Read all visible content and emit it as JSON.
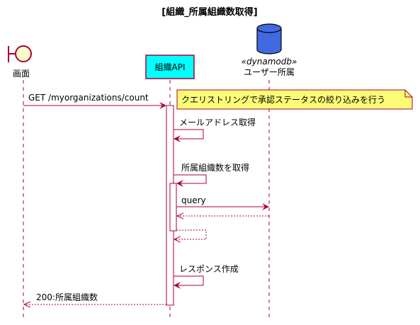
{
  "title": "[組織_所属組織数取得]",
  "participants": {
    "screen": {
      "label": "画面",
      "icon": "boundary-icon"
    },
    "api": {
      "label": "組織API"
    },
    "db": {
      "stereotype": "«dynamodb»",
      "label": "ユーザー所属",
      "icon": "database-icon"
    }
  },
  "messages": {
    "get_count": "GET /myorganizations/count",
    "mail": "メールアドレス取得",
    "orgs": "所属組織数を取得",
    "query": "query",
    "response": "レスポンス作成",
    "result": "200:所属組織数"
  },
  "note": "クエリストリングで承認ステータスの絞り込みを行う",
  "colors": {
    "arrow": "#A80036",
    "api_box": "#00FFFF",
    "db": "#4169E1",
    "boundary": "#FEFECE",
    "note": "#FBFB77"
  }
}
